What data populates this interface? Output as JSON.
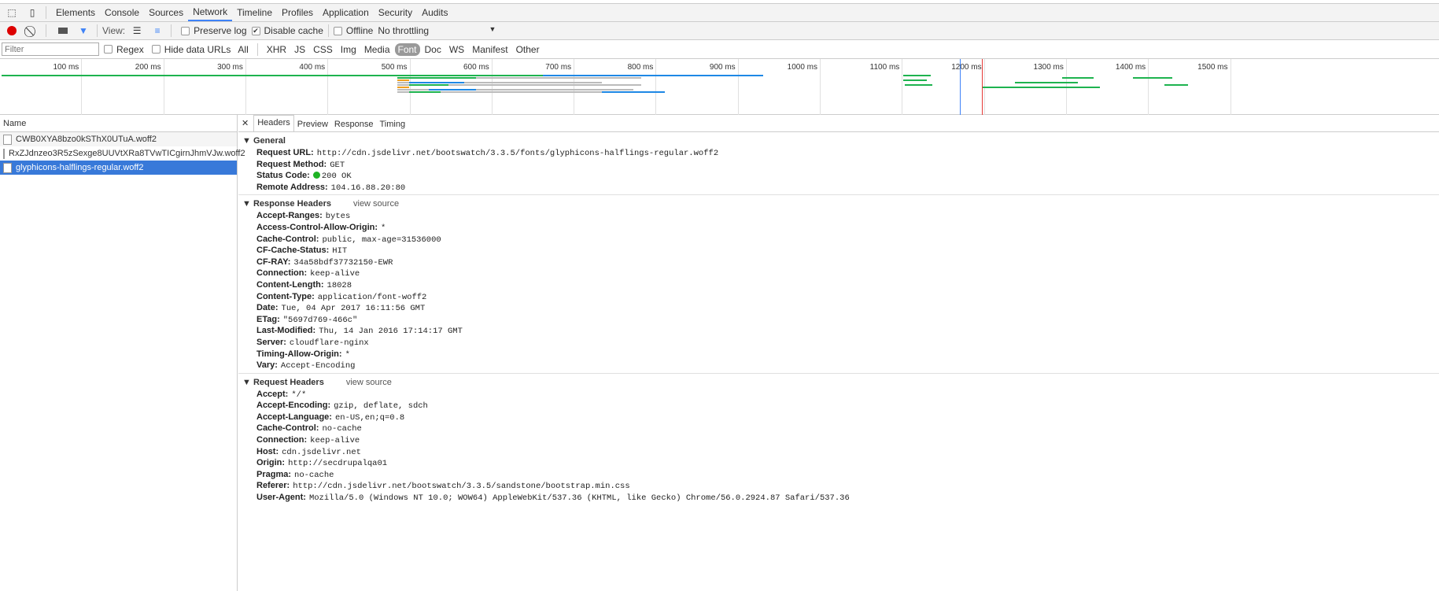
{
  "tabs": [
    "Elements",
    "Console",
    "Sources",
    "Network",
    "Timeline",
    "Profiles",
    "Application",
    "Security",
    "Audits"
  ],
  "toolbar": {
    "view_label": "View:",
    "preserve_log": "Preserve log",
    "disable_cache": "Disable cache",
    "offline": "Offline",
    "throttling": "No throttling"
  },
  "filterbar": {
    "placeholder": "Filter",
    "regex": "Regex",
    "hide_data_urls": "Hide data URLs",
    "types": [
      "All",
      "XHR",
      "JS",
      "CSS",
      "Img",
      "Media",
      "Font",
      "Doc",
      "WS",
      "Manifest",
      "Other"
    ]
  },
  "overview": {
    "ticks": [
      "100 ms",
      "200 ms",
      "300 ms",
      "400 ms",
      "500 ms",
      "600 ms",
      "700 ms",
      "800 ms",
      "900 ms",
      "1000 ms",
      "1100 ms",
      "1200 ms",
      "1300 ms",
      "1400 ms",
      "1500 ms"
    ]
  },
  "requests": {
    "header": "Name",
    "items": [
      "CWB0XYA8bzo0kSThX0UTuA.woff2",
      "RxZJdnzeo3R5zSexge8UUVtXRa8TVwTICgirnJhmVJw.woff2",
      "glyphicons-halflings-regular.woff2"
    ]
  },
  "detail_tabs": [
    "Headers",
    "Preview",
    "Response",
    "Timing"
  ],
  "general": {
    "title": "General",
    "rows": [
      [
        "Request URL:",
        "http://cdn.jsdelivr.net/bootswatch/3.3.5/fonts/glyphicons-halflings-regular.woff2"
      ],
      [
        "Request Method:",
        "GET"
      ],
      [
        "Status Code:",
        "200 OK"
      ],
      [
        "Remote Address:",
        "104.16.88.20:80"
      ]
    ]
  },
  "response_headers": {
    "title": "Response Headers",
    "view_source": "view source",
    "rows": [
      [
        "Accept-Ranges:",
        "bytes"
      ],
      [
        "Access-Control-Allow-Origin:",
        "*"
      ],
      [
        "Cache-Control:",
        "public, max-age=31536000"
      ],
      [
        "CF-Cache-Status:",
        "HIT"
      ],
      [
        "CF-RAY:",
        "34a58bdf37732150-EWR"
      ],
      [
        "Connection:",
        "keep-alive"
      ],
      [
        "Content-Length:",
        "18028"
      ],
      [
        "Content-Type:",
        "application/font-woff2"
      ],
      [
        "Date:",
        "Tue, 04 Apr 2017 16:11:56 GMT"
      ],
      [
        "ETag:",
        "\"5697d769-466c\""
      ],
      [
        "Last-Modified:",
        "Thu, 14 Jan 2016 17:14:17 GMT"
      ],
      [
        "Server:",
        "cloudflare-nginx"
      ],
      [
        "Timing-Allow-Origin:",
        "*"
      ],
      [
        "Vary:",
        "Accept-Encoding"
      ]
    ]
  },
  "request_headers": {
    "title": "Request Headers",
    "view_source": "view source",
    "rows": [
      [
        "Accept:",
        "*/*"
      ],
      [
        "Accept-Encoding:",
        "gzip, deflate, sdch"
      ],
      [
        "Accept-Language:",
        "en-US,en;q=0.8"
      ],
      [
        "Cache-Control:",
        "no-cache"
      ],
      [
        "Connection:",
        "keep-alive"
      ],
      [
        "Host:",
        "cdn.jsdelivr.net"
      ],
      [
        "Origin:",
        "http://secdrupalqa01"
      ],
      [
        "Pragma:",
        "no-cache"
      ],
      [
        "Referer:",
        "http://cdn.jsdelivr.net/bootswatch/3.3.5/sandstone/bootstrap.min.css"
      ],
      [
        "User-Agent:",
        "Mozilla/5.0 (Windows NT 10.0; WOW64) AppleWebKit/537.36 (KHTML, like Gecko) Chrome/56.0.2924.87 Safari/537.36"
      ]
    ]
  }
}
